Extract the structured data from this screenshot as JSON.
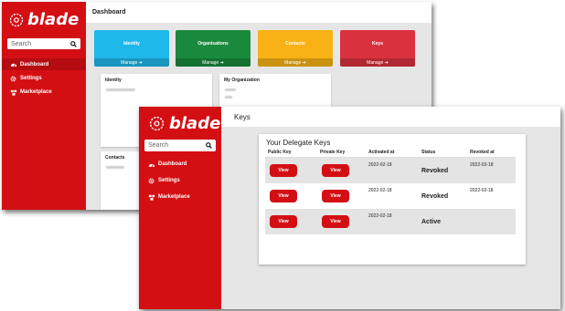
{
  "back": {
    "logo": "blade",
    "search_placeholder": "Search",
    "nav": [
      {
        "label": "Dashboard",
        "icon": "dashboard-icon"
      },
      {
        "label": "Settings",
        "icon": "gear-icon"
      },
      {
        "label": "Marketplace",
        "icon": "marketplace-icon"
      }
    ],
    "title": "Dashboard",
    "tiles": [
      {
        "label": "Identity",
        "manage": "Manage ➔",
        "color": "#1fb8ea"
      },
      {
        "label": "Organisations",
        "manage": "Manage ➔",
        "color": "#198a3d"
      },
      {
        "label": "Contacts",
        "manage": "Manage ➔",
        "color": "#f8b216"
      },
      {
        "label": "Keys",
        "manage": "Manage ➔",
        "color": "#d9313d"
      }
    ],
    "cards": {
      "identity": "Identity",
      "organization": "My Organization",
      "contacts": "Contacts"
    }
  },
  "front": {
    "logo": "blade",
    "search_placeholder": "Search",
    "nav": [
      {
        "label": "Dashboard",
        "icon": "dashboard-icon"
      },
      {
        "label": "Settings",
        "icon": "gear-icon"
      },
      {
        "label": "Marketplace",
        "icon": "marketplace-icon"
      }
    ],
    "title": "Keys",
    "panel_title": "Your Delegate Keys",
    "headers": [
      "Public Key",
      "Private Key",
      "Activated at",
      "Status",
      "Revoked at"
    ],
    "button_label": "View",
    "rows": [
      {
        "activated": "2022-02-18",
        "status": "Revoked",
        "revoked": "2022-02-18"
      },
      {
        "activated": "2022-02-18",
        "status": "Revoked",
        "revoked": "2022-02-18"
      },
      {
        "activated": "2022-02-18",
        "status": "Active",
        "revoked": ""
      }
    ]
  },
  "colors": {
    "brand_red": "#d40f14"
  }
}
